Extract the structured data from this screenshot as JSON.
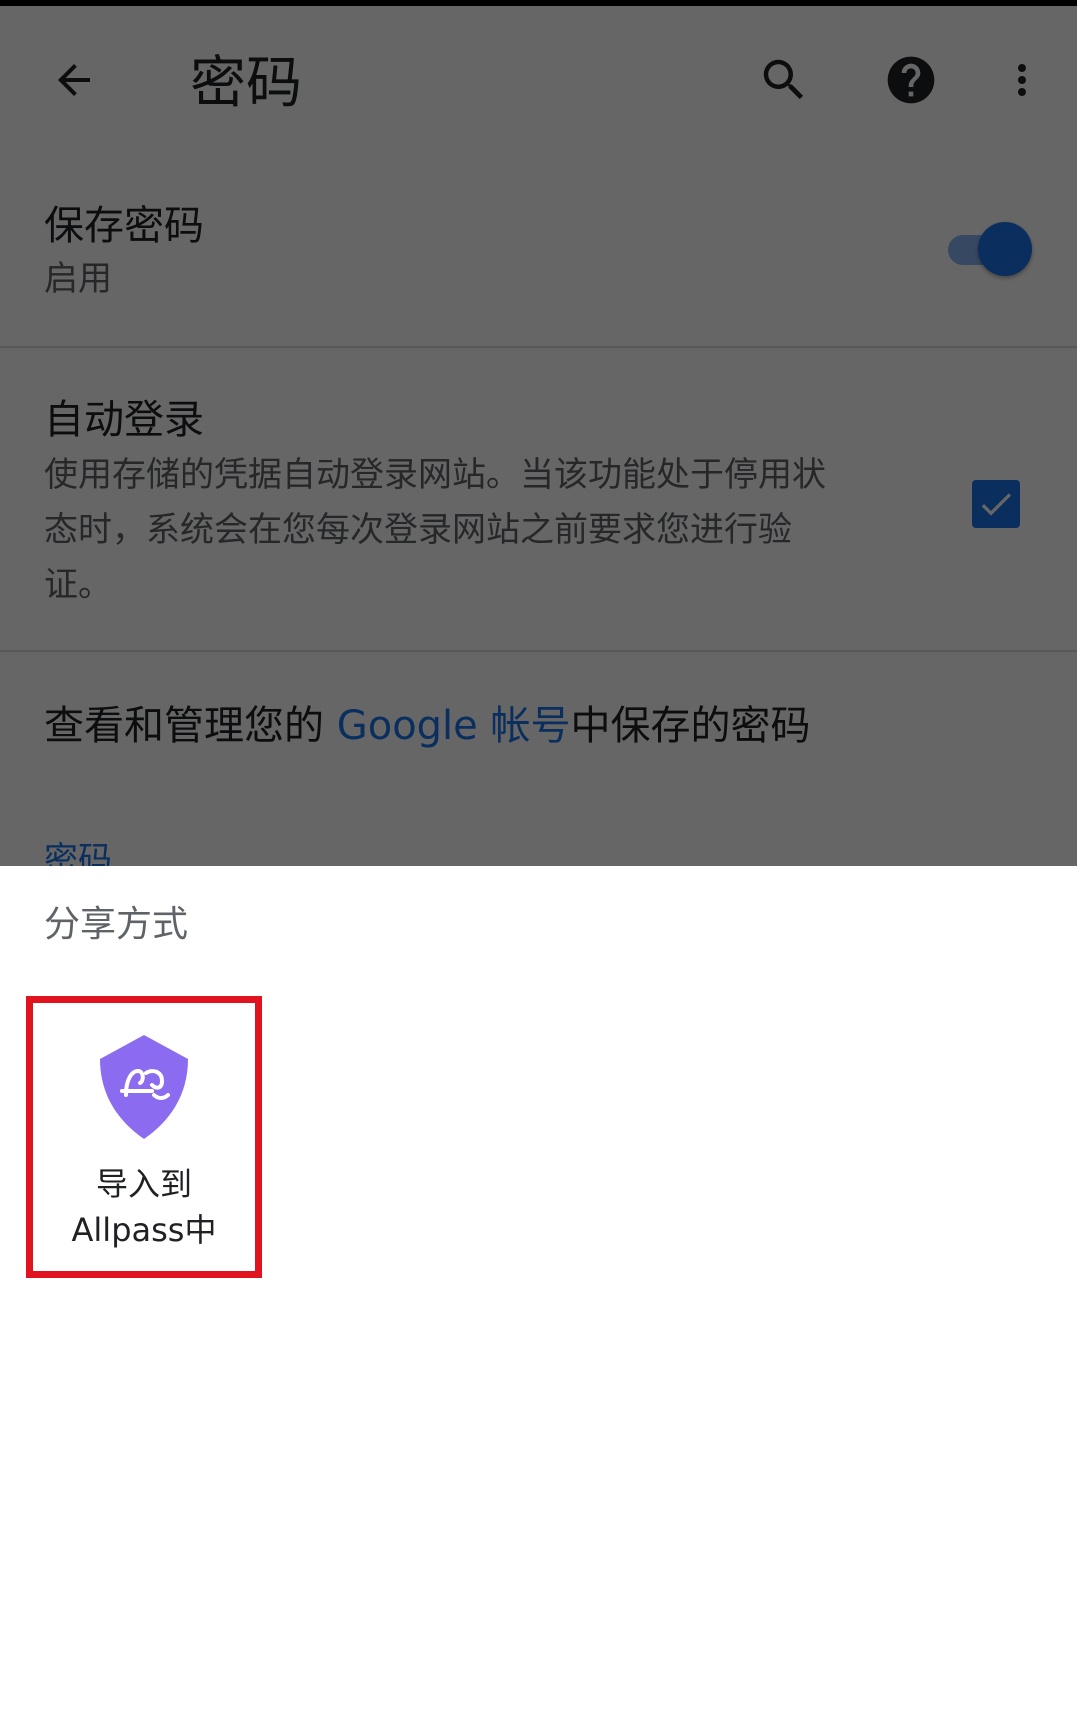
{
  "toolbar": {
    "title": "密码"
  },
  "save_passwords": {
    "title": "保存密码",
    "status": "启用",
    "enabled": true
  },
  "auto_signin": {
    "title": "自动登录",
    "description_lines": [
      "使用存储的凭据自动登录网站。当该功能处于停用状",
      "态时，系统会在您每次登录网站之前要求您进行验",
      "证。"
    ],
    "checked": true
  },
  "manage": {
    "prefix": "查看和管理您的 ",
    "link": "Google 帐号",
    "suffix": "中保存的密码"
  },
  "section_header": "密码",
  "share_sheet": {
    "title": "分享方式",
    "targets": [
      {
        "label_line1": "导入到",
        "label_line2": "Allpass中",
        "icon": "allpass-shield-icon"
      }
    ]
  },
  "colors": {
    "accent": "#1a73e8",
    "highlight_border": "#e1131f",
    "app_icon": "#8b6cf0"
  }
}
